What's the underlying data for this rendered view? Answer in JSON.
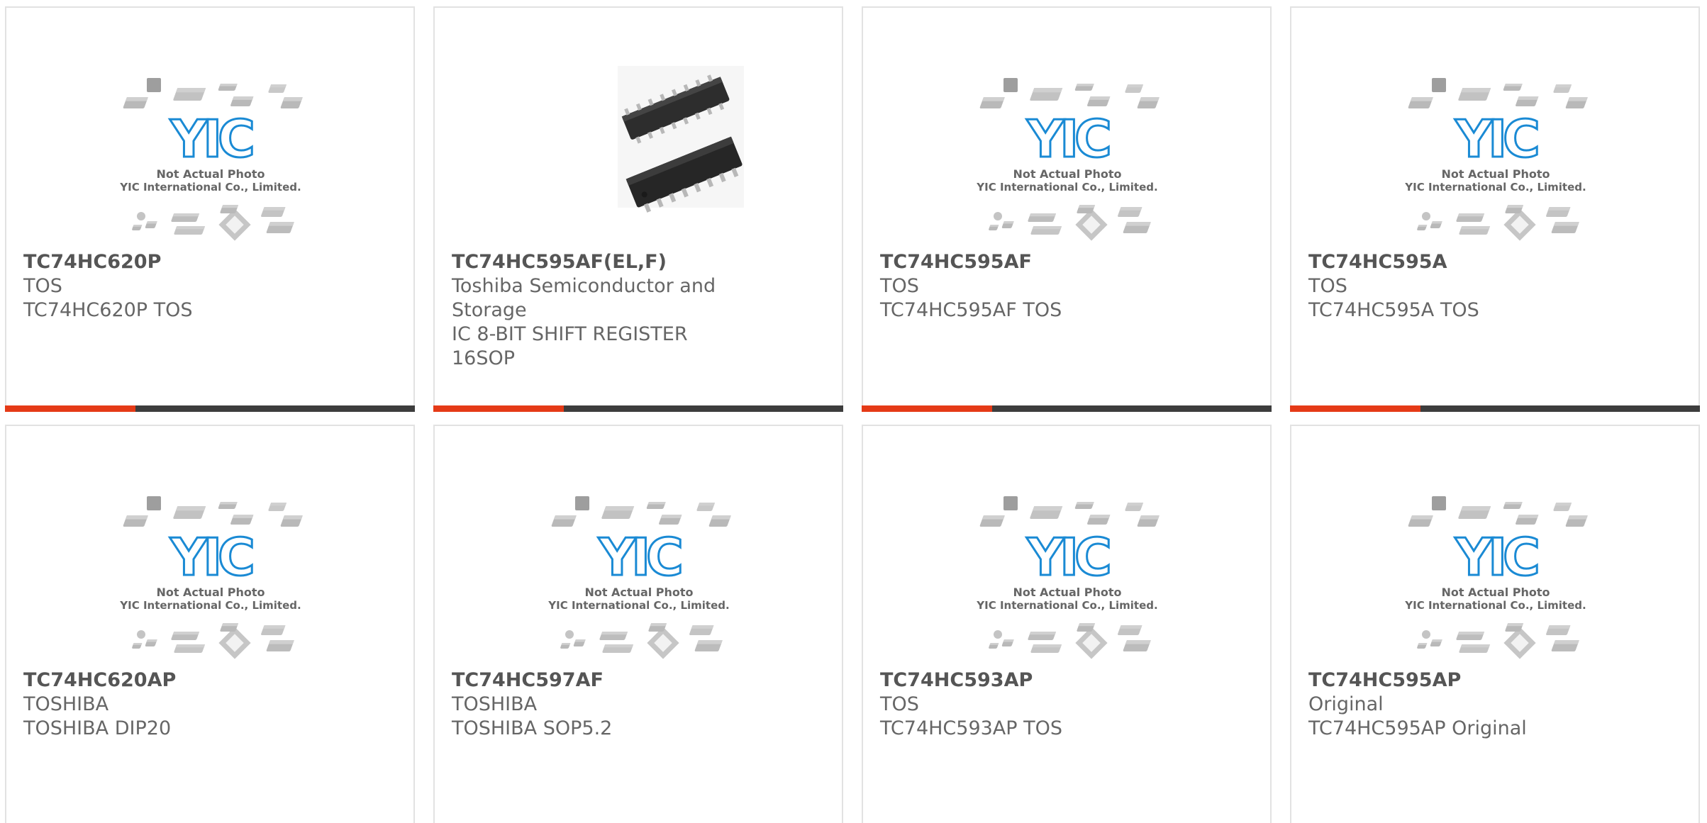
{
  "products": [
    {
      "part": "TC74HC620P",
      "lines": [
        "TOS",
        "TC74HC620P TOS"
      ],
      "image": "placeholder",
      "placeholder_text": [
        "Not Actual Photo",
        "YIC International Co., Limited."
      ]
    },
    {
      "part": "TC74HC595AF(EL,F)",
      "lines": [
        "Toshiba Semiconductor and",
        "Storage",
        "IC 8-BIT SHIFT REGISTER 16SOP"
      ],
      "image": "photo"
    },
    {
      "part": "TC74HC595AF",
      "lines": [
        "TOS",
        "TC74HC595AF TOS"
      ],
      "image": "placeholder",
      "placeholder_text": [
        "Not Actual Photo",
        "YIC International Co., Limited."
      ]
    },
    {
      "part": "TC74HC595A",
      "lines": [
        "TOS",
        "TC74HC595A TOS"
      ],
      "image": "placeholder",
      "placeholder_text": [
        "Not Actual Photo",
        "YIC International Co., Limited."
      ]
    },
    {
      "part": "TC74HC620AP",
      "lines": [
        "TOSHIBA",
        "TOSHIBA DIP20"
      ],
      "image": "placeholder",
      "placeholder_text": [
        "Not Actual Photo",
        "YIC International Co., Limited."
      ]
    },
    {
      "part": "TC74HC597AF",
      "lines": [
        "TOSHIBA",
        "TOSHIBA SOP5.2"
      ],
      "image": "placeholder",
      "placeholder_text": [
        "Not Actual Photo",
        "YIC International Co., Limited."
      ]
    },
    {
      "part": "TC74HC593AP",
      "lines": [
        "TOS",
        "TC74HC593AP TOS"
      ],
      "image": "placeholder",
      "placeholder_text": [
        "Not Actual Photo",
        "YIC International Co., Limited."
      ]
    },
    {
      "part": "TC74HC595AP",
      "lines": [
        "Original",
        "TC74HC595AP Original"
      ],
      "image": "placeholder",
      "placeholder_text": [
        "Not Actual Photo",
        "YIC International Co., Limited."
      ]
    }
  ],
  "logo_text": "YIC",
  "colors": {
    "accent_red": "#e53a17",
    "accent_dark": "#3d3d3d",
    "logo_blue": "#1a8ad4",
    "text": "#555555"
  }
}
